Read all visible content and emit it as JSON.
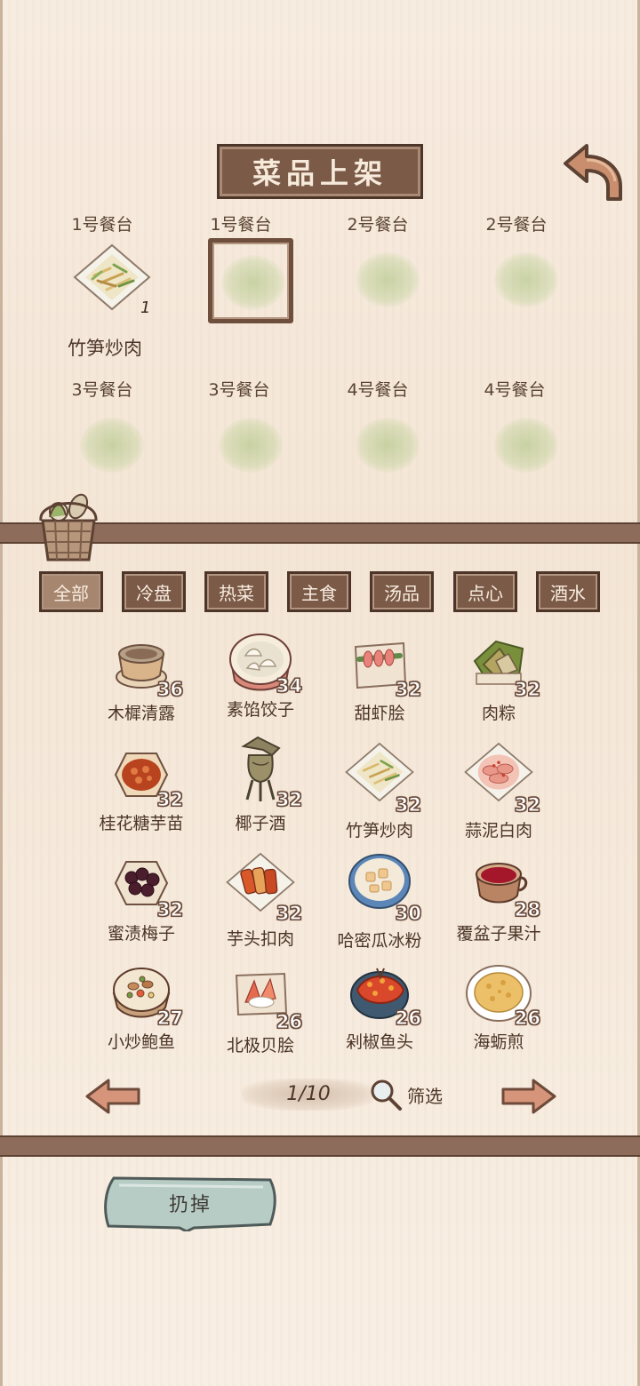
{
  "header": {
    "title": "菜品上架",
    "back_icon": "curved-back-arrow-icon"
  },
  "counters": [
    {
      "label": "1号餐台",
      "dish": "竹笋炒肉",
      "count": "1",
      "selected": false
    },
    {
      "label": "1号餐台",
      "dish": "",
      "count": "",
      "selected": true
    },
    {
      "label": "2号餐台",
      "dish": "",
      "count": "",
      "selected": false
    },
    {
      "label": "2号餐台",
      "dish": "",
      "count": "",
      "selected": false
    },
    {
      "label": "3号餐台",
      "dish": "",
      "count": "",
      "selected": false
    },
    {
      "label": "3号餐台",
      "dish": "",
      "count": "",
      "selected": false
    },
    {
      "label": "4号餐台",
      "dish": "",
      "count": "",
      "selected": false
    },
    {
      "label": "4号餐台",
      "dish": "",
      "count": "",
      "selected": false
    }
  ],
  "tabs": [
    {
      "label": "全部",
      "active": true
    },
    {
      "label": "冷盘",
      "active": false
    },
    {
      "label": "热菜",
      "active": false
    },
    {
      "label": "主食",
      "active": false
    },
    {
      "label": "汤品",
      "active": false
    },
    {
      "label": "点心",
      "active": false
    },
    {
      "label": "酒水",
      "active": false
    }
  ],
  "dishes": [
    {
      "name": "木樨清露",
      "qty": "36",
      "icon": "clear-dew-cup"
    },
    {
      "name": "素馅饺子",
      "qty": "34",
      "icon": "dumpling-steamer"
    },
    {
      "name": "甜虾脍",
      "qty": "32",
      "icon": "shrimp-plate"
    },
    {
      "name": "肉粽",
      "qty": "32",
      "icon": "zongzi"
    },
    {
      "name": "桂花糖芋苗",
      "qty": "32",
      "icon": "taro-bowl"
    },
    {
      "name": "椰子酒",
      "qty": "32",
      "icon": "bronze-wine-vessel"
    },
    {
      "name": "竹笋炒肉",
      "qty": "32",
      "icon": "bamboo-pork-plate"
    },
    {
      "name": "蒜泥白肉",
      "qty": "32",
      "icon": "garlic-pork-plate"
    },
    {
      "name": "蜜渍梅子",
      "qty": "32",
      "icon": "plum-bowl"
    },
    {
      "name": "芋头扣肉",
      "qty": "32",
      "icon": "taro-pork-plate"
    },
    {
      "name": "哈密瓜冰粉",
      "qty": "30",
      "icon": "melon-jelly-bowl"
    },
    {
      "name": "覆盆子果汁",
      "qty": "28",
      "icon": "raspberry-juice-cup"
    },
    {
      "name": "小炒鲍鱼",
      "qty": "27",
      "icon": "abalone-bowl"
    },
    {
      "name": "北极贝脍",
      "qty": "26",
      "icon": "clam-plate"
    },
    {
      "name": "剁椒鱼头",
      "qty": "26",
      "icon": "fish-head-dish"
    },
    {
      "name": "海蛎煎",
      "qty": "26",
      "icon": "oyster-omelette"
    }
  ],
  "pagination": {
    "page_label": "1/10",
    "filter_label": "筛选"
  },
  "actions": {
    "discard_label": "扔掉"
  },
  "colors": {
    "wood_dark": "#7b5a47",
    "divider": "#8e6c5b",
    "background": "#f5e8da",
    "jade_button": "#b8ccc6"
  }
}
